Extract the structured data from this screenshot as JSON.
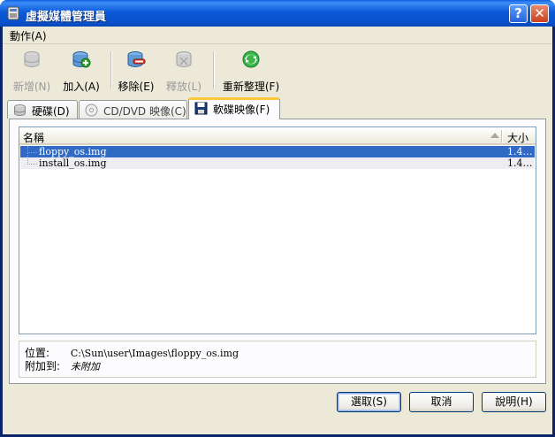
{
  "window": {
    "title": "虛擬媒體管理員",
    "help_glyph": "?",
    "close_glyph": "✕"
  },
  "menu": {
    "items": [
      {
        "label": "動作(A)"
      }
    ]
  },
  "toolbar": {
    "new_label": "新增(N)",
    "add_label": "加入(A)",
    "remove_label": "移除(E)",
    "release_label": "釋放(L)",
    "refresh_label": "重新整理(F)"
  },
  "tabs": [
    {
      "label": "硬碟(D)",
      "icon": "hard-disk-icon"
    },
    {
      "label": "CD/DVD 映像(C)",
      "icon": "cd-icon"
    },
    {
      "label": "軟碟映像(F)",
      "icon": "floppy-icon"
    }
  ],
  "list": {
    "col_name": "名稱",
    "col_size": "大小",
    "rows": [
      {
        "name": "floppy_os.img",
        "size": "1.4…",
        "selected": true
      },
      {
        "name": "install_os.img",
        "size": "1.4…",
        "selected": false
      }
    ]
  },
  "info": {
    "location_label": "位置:",
    "location_value": "C:\\Sun\\user\\Images\\floppy_os.img",
    "attached_label": "附加到:",
    "attached_value": "未附加"
  },
  "buttons": {
    "select": "選取(S)",
    "cancel": "取消",
    "help": "說明(H)"
  },
  "colors": {
    "titlebar": "#0a5fe0",
    "selection": "#316ac5",
    "active_tab_accent": "#ffc73c",
    "dialog_bg": "#ece9d8"
  }
}
